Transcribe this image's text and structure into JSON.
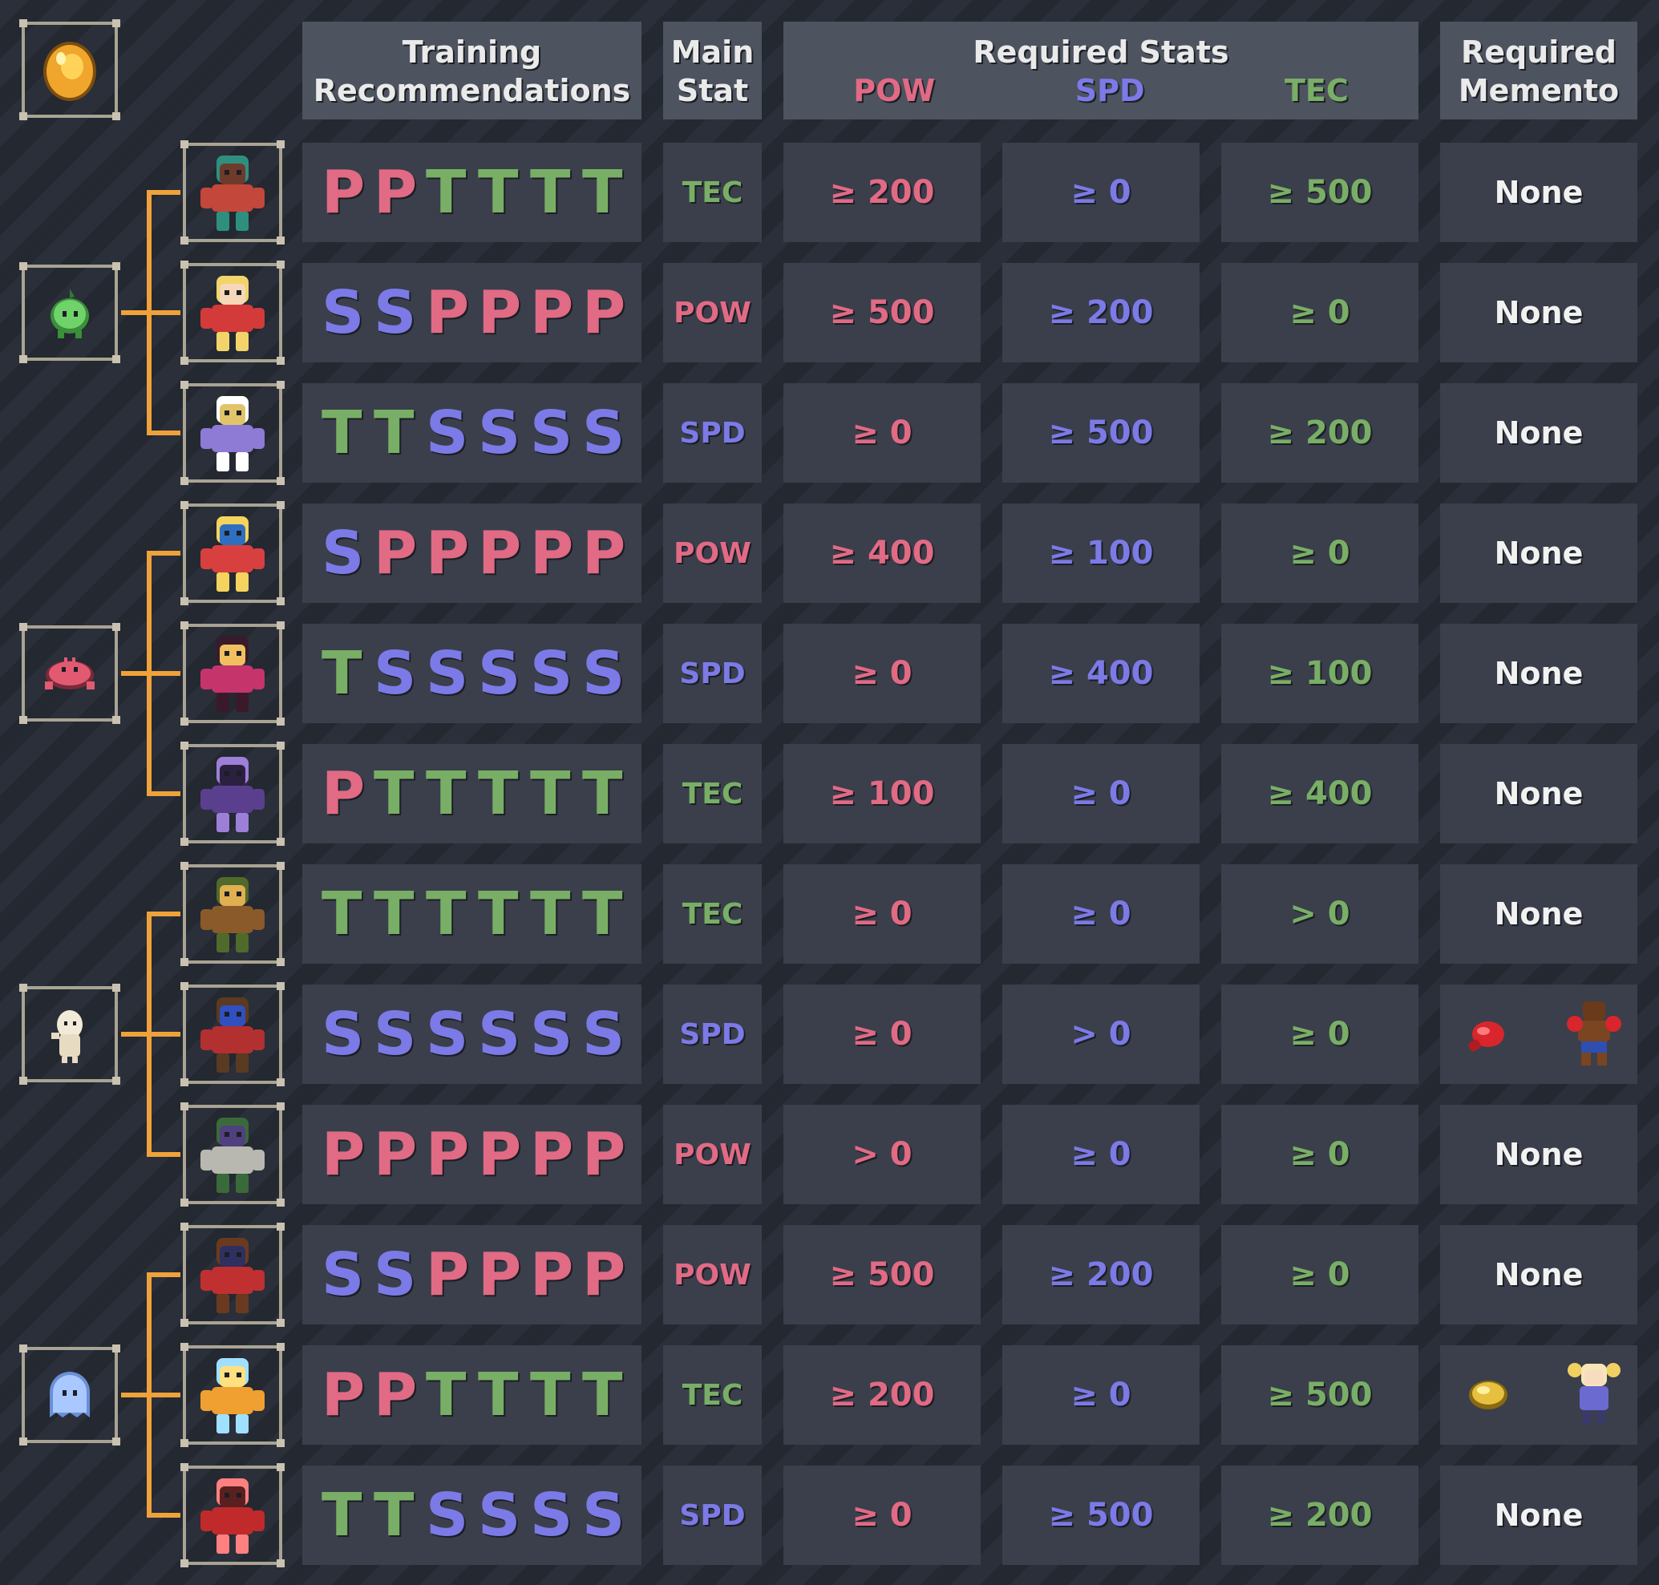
{
  "headers": {
    "training": [
      "Training",
      "Recommendations"
    ],
    "main_stat": [
      "Main",
      "Stat"
    ],
    "required_stats": "Required Stats",
    "pow": "POW",
    "spd": "SPD",
    "tec": "TEC",
    "memento": [
      "Required",
      "Memento"
    ]
  },
  "colors": {
    "pow": "#e16a85",
    "spd": "#7c7ae6",
    "tec": "#79ae66",
    "line": "#f0a23a"
  },
  "egg": {
    "icon": "golden-egg-icon"
  },
  "groups": [
    {
      "baby_icon": "green-sprout-icon",
      "rows": [
        0,
        1,
        2
      ]
    },
    {
      "baby_icon": "red-crab-icon",
      "rows": [
        3,
        4,
        5
      ]
    },
    {
      "baby_icon": "white-ghost-icon",
      "rows": [
        6,
        7,
        8
      ]
    },
    {
      "baby_icon": "blue-ghost-icon",
      "rows": [
        9,
        10,
        11
      ]
    }
  ],
  "rows": [
    {
      "monster_icon": "red-ogre-icon",
      "training": [
        "P",
        "P",
        "T",
        "T",
        "T",
        "T"
      ],
      "main_stat": "TEC",
      "pow": "≥ 200",
      "spd": "≥ 0",
      "tec": "≥ 500",
      "memento": "None"
    },
    {
      "monster_icon": "red-hood-girl-icon",
      "training": [
        "S",
        "S",
        "P",
        "P",
        "P",
        "P"
      ],
      "main_stat": "POW",
      "pow": "≥ 500",
      "spd": "≥ 200",
      "tec": "≥ 0",
      "memento": "None"
    },
    {
      "monster_icon": "winged-fairy-icon",
      "training": [
        "T",
        "T",
        "S",
        "S",
        "S",
        "S"
      ],
      "main_stat": "SPD",
      "pow": "≥ 0",
      "spd": "≥ 500",
      "tec": "≥ 200",
      "memento": "None"
    },
    {
      "monster_icon": "blonde-fighter-icon",
      "training": [
        "S",
        "P",
        "P",
        "P",
        "P",
        "P"
      ],
      "main_stat": "POW",
      "pow": "≥ 400",
      "spd": "≥ 100",
      "tec": "≥ 0",
      "memento": "None"
    },
    {
      "monster_icon": "succubus-girl-icon",
      "training": [
        "T",
        "S",
        "S",
        "S",
        "S",
        "S"
      ],
      "main_stat": "SPD",
      "pow": "≥ 0",
      "spd": "≥ 400",
      "tec": "≥ 100",
      "memento": "None"
    },
    {
      "monster_icon": "dark-bat-demon-icon",
      "training": [
        "P",
        "T",
        "T",
        "T",
        "T",
        "T"
      ],
      "main_stat": "TEC",
      "pow": "≥ 100",
      "spd": "≥ 0",
      "tec": "≥ 400",
      "memento": "None"
    },
    {
      "monster_icon": "beast-warrior-icon",
      "training": [
        "T",
        "T",
        "T",
        "T",
        "T",
        "T"
      ],
      "main_stat": "TEC",
      "pow": "≥ 0",
      "spd": "≥ 0",
      "tec": "> 0",
      "memento": "None"
    },
    {
      "monster_icon": "street-brawler-icon",
      "training": [
        "S",
        "S",
        "S",
        "S",
        "S",
        "S"
      ],
      "main_stat": "SPD",
      "pow": "≥ 0",
      "spd": "> 0",
      "tec": "≥ 0",
      "memento": "",
      "memento_icons": [
        "boxing-glove-icon",
        "boxer-icon"
      ]
    },
    {
      "monster_icon": "old-master-icon",
      "training": [
        "P",
        "P",
        "P",
        "P",
        "P",
        "P"
      ],
      "main_stat": "POW",
      "pow": "> 0",
      "spd": "≥ 0",
      "tec": "≥ 0",
      "memento": "None"
    },
    {
      "monster_icon": "red-hair-brawler-icon",
      "training": [
        "S",
        "S",
        "P",
        "P",
        "P",
        "P"
      ],
      "main_stat": "POW",
      "pow": "≥ 500",
      "spd": "≥ 200",
      "tec": "≥ 0",
      "memento": "None"
    },
    {
      "monster_icon": "fire-wave-spirit-icon",
      "training": [
        "P",
        "P",
        "T",
        "T",
        "T",
        "T"
      ],
      "main_stat": "TEC",
      "pow": "≥ 200",
      "spd": "≥ 0",
      "tec": "≥ 500",
      "memento": "",
      "memento_icons": [
        "golden-seed-icon",
        "blonde-twin-tail-girl-icon"
      ]
    },
    {
      "monster_icon": "red-aura-fighter-icon",
      "training": [
        "T",
        "T",
        "S",
        "S",
        "S",
        "S"
      ],
      "main_stat": "SPD",
      "pow": "≥ 0",
      "spd": "≥ 500",
      "tec": "≥ 200",
      "memento": "None"
    }
  ]
}
